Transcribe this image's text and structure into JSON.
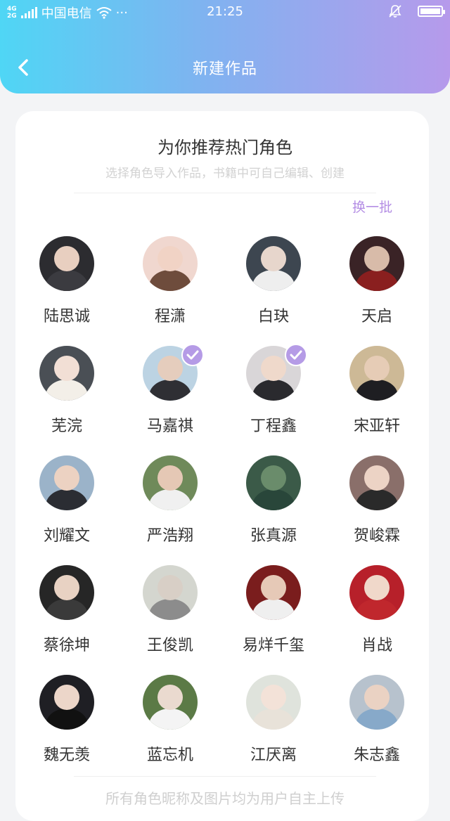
{
  "status": {
    "network": "4G",
    "network2": "2G",
    "carrier": "中国电信",
    "dots": "···",
    "time": "21:25",
    "battery_level": 1.0
  },
  "header": {
    "title": "新建作品",
    "back_icon": "chevron-left-icon"
  },
  "section": {
    "title": "为你推荐热门角色",
    "subtitle": "选择角色导入作品，书籍中可自己编辑、创建",
    "refresh_label": "换一批"
  },
  "characters": [
    {
      "name": "陆思诚",
      "selected": false,
      "bg": "#2c2c30",
      "skin": "#e8cfc0",
      "cloth": "#3b3b40"
    },
    {
      "name": "程潇",
      "selected": false,
      "bg": "#f0d7cf",
      "skin": "#f1d3c5",
      "cloth": "#6e4c3c"
    },
    {
      "name": "白玦",
      "selected": false,
      "bg": "#3d4650",
      "skin": "#e7d6cc",
      "cloth": "#eeeeee"
    },
    {
      "name": "天启",
      "selected": false,
      "bg": "#3a2326",
      "skin": "#d8bba9",
      "cloth": "#8a1f1f"
    },
    {
      "name": "芜浣",
      "selected": false,
      "bg": "#4a4f55",
      "skin": "#f2dfd5",
      "cloth": "#f3efe8"
    },
    {
      "name": "马嘉祺",
      "selected": true,
      "bg": "#bcd3e3",
      "skin": "#e5cdbd",
      "cloth": "#2f2f34"
    },
    {
      "name": "丁程鑫",
      "selected": true,
      "bg": "#d9d6d8",
      "skin": "#efd9cb",
      "cloth": "#2a2a2e"
    },
    {
      "name": "宋亚轩",
      "selected": false,
      "bg": "#cdb996",
      "skin": "#e6ccb6",
      "cloth": "#1e1e22"
    },
    {
      "name": "刘耀文",
      "selected": false,
      "bg": "#9bb3c9",
      "skin": "#ecd2c2",
      "cloth": "#2b2d33"
    },
    {
      "name": "严浩翔",
      "selected": false,
      "bg": "#6f8a5a",
      "skin": "#e5c8b5",
      "cloth": "#f0f0f0"
    },
    {
      "name": "张真源",
      "selected": false,
      "bg": "#3b5a48",
      "skin": "#6a8c6b",
      "cloth": "#29463a"
    },
    {
      "name": "贺峻霖",
      "selected": false,
      "bg": "#8a6f6a",
      "skin": "#ecd3c5",
      "cloth": "#2a2a2a"
    },
    {
      "name": "蔡徐坤",
      "selected": false,
      "bg": "#262626",
      "skin": "#e8d2c3",
      "cloth": "#3a3a3a"
    },
    {
      "name": "王俊凯",
      "selected": false,
      "bg": "#d4d6cf",
      "skin": "#d8cfc6",
      "cloth": "#8c8c8c"
    },
    {
      "name": "易烊千玺",
      "selected": false,
      "bg": "#7a1d1d",
      "skin": "#e6c9b7",
      "cloth": "#efefef"
    },
    {
      "name": "肖战",
      "selected": false,
      "bg": "#b7202a",
      "skin": "#f0d8ca",
      "cloth": "#c0272d"
    },
    {
      "name": "魏无羡",
      "selected": false,
      "bg": "#1f1f24",
      "skin": "#ecd6c9",
      "cloth": "#111111"
    },
    {
      "name": "蓝忘机",
      "selected": false,
      "bg": "#5b7a46",
      "skin": "#eadacf",
      "cloth": "#f4f4f4"
    },
    {
      "name": "江厌离",
      "selected": false,
      "bg": "#dfe3dc",
      "skin": "#f3e2d8",
      "cloth": "#e8e2d9"
    },
    {
      "name": "朱志鑫",
      "selected": false,
      "bg": "#b7c2cd",
      "skin": "#ead2c3",
      "cloth": "#87a9c9"
    }
  ],
  "footer": {
    "note": "所有角色昵称及图片均为用户自主上传"
  },
  "colors": {
    "accent": "#b48ee4",
    "check_badge": "#b59be6",
    "header_gradient_start": "#4fd6f5",
    "header_gradient_end": "#b69aeb"
  }
}
